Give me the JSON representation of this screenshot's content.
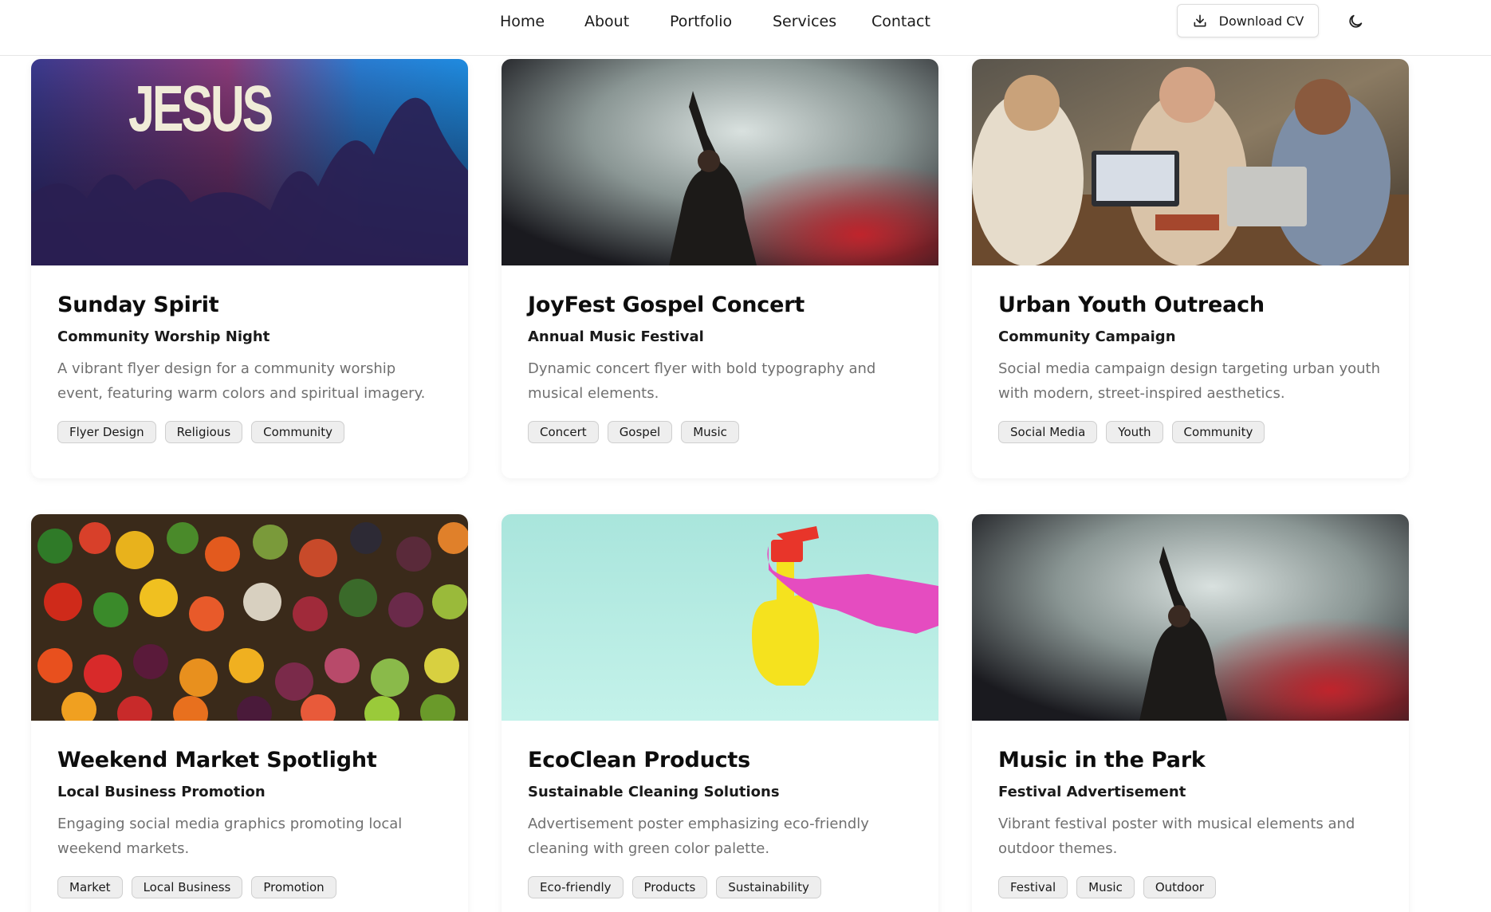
{
  "nav": {
    "items": [
      {
        "label": "Home"
      },
      {
        "label": "About"
      },
      {
        "label": "Portfolio"
      },
      {
        "label": "Services"
      },
      {
        "label": "Contact"
      }
    ],
    "download_label": "Download CV",
    "download_icon": "download-icon",
    "theme_icon": "moon-icon"
  },
  "projects": [
    {
      "title": "Sunday Spirit",
      "subtitle": "Community Worship Night",
      "description": "A vibrant flyer design for a community worship event, featuring warm colors and spiritual imagery.",
      "image_text": "JESUS",
      "tags": [
        "Flyer Design",
        "Religious",
        "Community"
      ]
    },
    {
      "title": "JoyFest Gospel Concert",
      "subtitle": "Annual Music Festival",
      "description": "Dynamic concert flyer with bold typography and musical elements.",
      "tags": [
        "Concert",
        "Gospel",
        "Music"
      ]
    },
    {
      "title": "Urban Youth Outreach",
      "subtitle": "Community Campaign",
      "description": "Social media campaign design targeting urban youth with modern, street-inspired aesthetics.",
      "tags": [
        "Social Media",
        "Youth",
        "Community"
      ]
    },
    {
      "title": "Weekend Market Spotlight",
      "subtitle": "Local Business Promotion",
      "description": "Engaging social media graphics promoting local weekend markets.",
      "tags": [
        "Market",
        "Local Business",
        "Promotion"
      ]
    },
    {
      "title": "EcoClean Products",
      "subtitle": "Sustainable Cleaning Solutions",
      "description": "Advertisement poster emphasizing eco-friendly cleaning with green color palette.",
      "tags": [
        "Eco-friendly",
        "Products",
        "Sustainability"
      ]
    },
    {
      "title": "Music in the Park",
      "subtitle": "Festival Advertisement",
      "description": "Vibrant festival poster with musical elements and outdoor themes.",
      "tags": [
        "Festival",
        "Music",
        "Outdoor"
      ]
    }
  ]
}
